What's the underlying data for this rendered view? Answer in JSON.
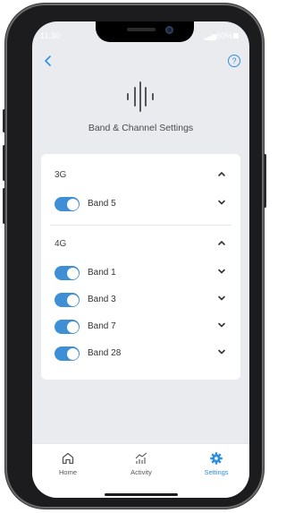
{
  "status_bar": {
    "time": "11:30",
    "battery": "60%"
  },
  "header": {
    "back_icon": "chevron-left-icon",
    "help_icon": "question-circle-icon"
  },
  "page": {
    "title": "Band & Channel Settings"
  },
  "groups": [
    {
      "label": "3G",
      "expanded": true,
      "bands": [
        {
          "label": "Band 5",
          "enabled": true
        }
      ]
    },
    {
      "label": "4G",
      "expanded": true,
      "bands": [
        {
          "label": "Band 1",
          "enabled": true
        },
        {
          "label": "Band 3",
          "enabled": true
        },
        {
          "label": "Band 7",
          "enabled": true
        },
        {
          "label": "Band 28",
          "enabled": true
        }
      ]
    }
  ],
  "nav": {
    "items": [
      {
        "label": "Home",
        "icon": "home-icon",
        "active": false
      },
      {
        "label": "Activity",
        "icon": "activity-chart-icon",
        "active": false
      },
      {
        "label": "Settings",
        "icon": "gear-icon",
        "active": true
      }
    ]
  },
  "colors": {
    "accent": "#2f8fe0",
    "toggle_on": "#3e8fd6",
    "background": "#e9ebef"
  }
}
